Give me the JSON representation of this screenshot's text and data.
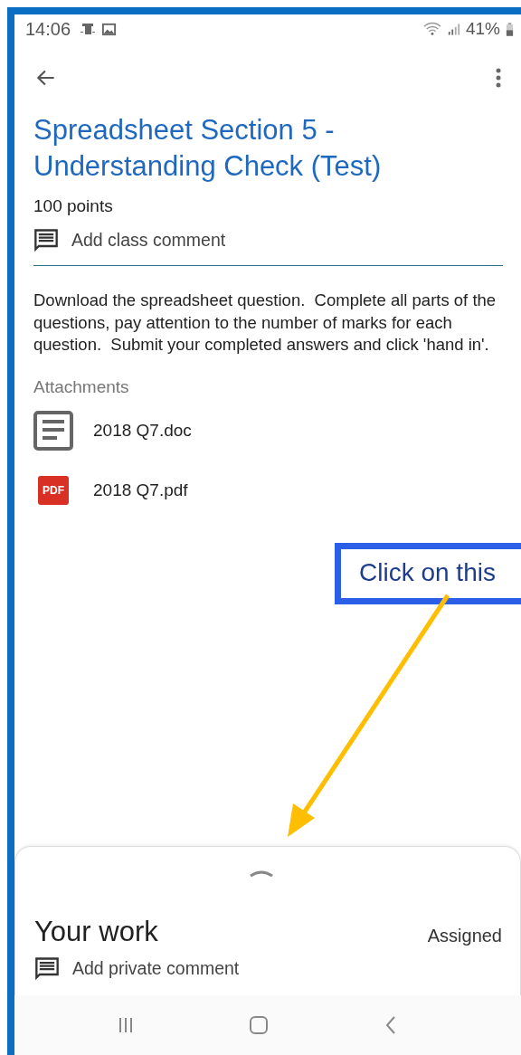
{
  "status_bar": {
    "time": "14:06",
    "battery": "41%"
  },
  "title": "Spreadsheet Section 5 - Understanding Check (Test)",
  "points": "100 points",
  "class_comment": {
    "placeholder": "Add class comment"
  },
  "description": "Download the spreadsheet question.  Complete all parts of the questions, pay attention to the number of marks for each question.  Submit your completed answers and click 'hand in'.",
  "attachments_label": "Attachments",
  "attachments": [
    {
      "name": "2018 Q7.doc",
      "kind": "doc"
    },
    {
      "name": "2018 Q7.pdf",
      "kind": "pdf",
      "icon_label": "PDF"
    }
  ],
  "callout": "Click on this",
  "your_work": {
    "title": "Your work",
    "status": "Assigned",
    "private_comment": "Add private comment"
  }
}
